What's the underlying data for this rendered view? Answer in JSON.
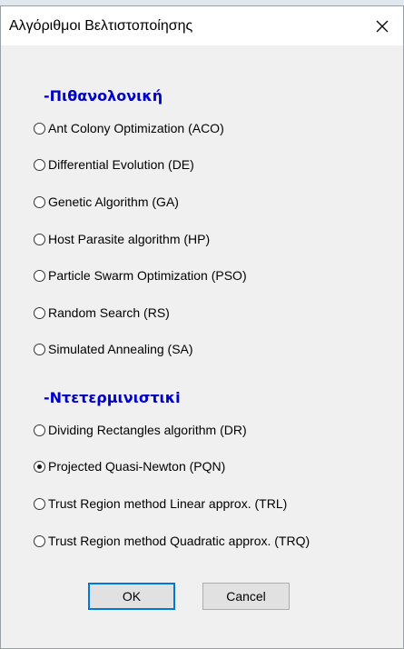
{
  "window": {
    "title": "Αλγόριθμοι Βελτιστοποίησης"
  },
  "sections": [
    {
      "title": "-Πιθανολονική",
      "options": [
        {
          "label": "Ant Colony Optimization (ACO)",
          "selected": false
        },
        {
          "label": "Differential Evolution (DE)",
          "selected": false
        },
        {
          "label": "Genetic Algorithm (GA)",
          "selected": false
        },
        {
          "label": "Host Parasite algorithm (HP)",
          "selected": false
        },
        {
          "label": "Particle Swarm Optimization (PSO)",
          "selected": false
        },
        {
          "label": "Random Search (RS)",
          "selected": false
        },
        {
          "label": "Simulated Annealing (SA)",
          "selected": false
        }
      ]
    },
    {
      "title": "-Ντετερμινιστικi",
      "options": [
        {
          "label": "Dividing Rectangles algorithm (DR)",
          "selected": false
        },
        {
          "label": "Projected Quasi-Newton (PQN)",
          "selected": true
        },
        {
          "label": "Trust Region method Linear approx. (TRL)",
          "selected": false
        },
        {
          "label": "Trust Region method Quadratic approx. (TRQ)",
          "selected": false
        }
      ]
    }
  ],
  "buttons": {
    "ok_label": "OK",
    "cancel_label": "Cancel"
  },
  "icons": {
    "close": "close-icon"
  },
  "colors": {
    "section_title": "#0000cc",
    "default_button_border": "#0078d7"
  }
}
